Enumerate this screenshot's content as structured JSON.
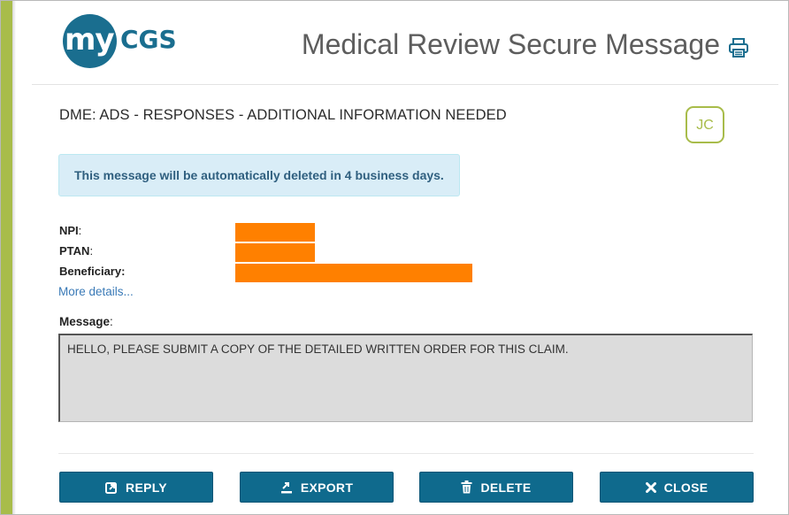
{
  "header": {
    "logo_my": "my",
    "logo_cgs": "CGS",
    "title": "Medical Review Secure Message",
    "print_icon": "print-icon"
  },
  "message": {
    "subject": "DME: ADS - RESPONSES - ADDITIONAL INFORMATION NEEDED",
    "initials": "JC",
    "alert": "This message will be automatically deleted in 4 business days.",
    "fields": [
      {
        "label": "NPI",
        "suffix": ":",
        "value_redacted": true
      },
      {
        "label": "PTAN",
        "suffix": ":",
        "value_redacted": true
      },
      {
        "label": "Beneficiary:",
        "suffix": "",
        "value_redacted": true
      }
    ],
    "more_details": "More details...",
    "body_label": "Message",
    "body_suffix": ":",
    "body": "HELLO, PLEASE SUBMIT A COPY OF THE DETAILED WRITTEN ORDER FOR THIS CLAIM."
  },
  "buttons": {
    "reply": {
      "label": "REPLY",
      "icon": "reply-icon"
    },
    "export": {
      "label": "EXPORT",
      "icon": "export-icon"
    },
    "delete": {
      "label": "DELETE",
      "icon": "trash-icon"
    },
    "close": {
      "label": "CLOSE",
      "icon": "close-icon"
    }
  },
  "colors": {
    "accent_green": "#a8bc4a",
    "brand_blue": "#1a6e8f",
    "button_blue": "#0f6a8d",
    "redaction": "#ff8000",
    "alert_bg": "#d9edf7"
  }
}
